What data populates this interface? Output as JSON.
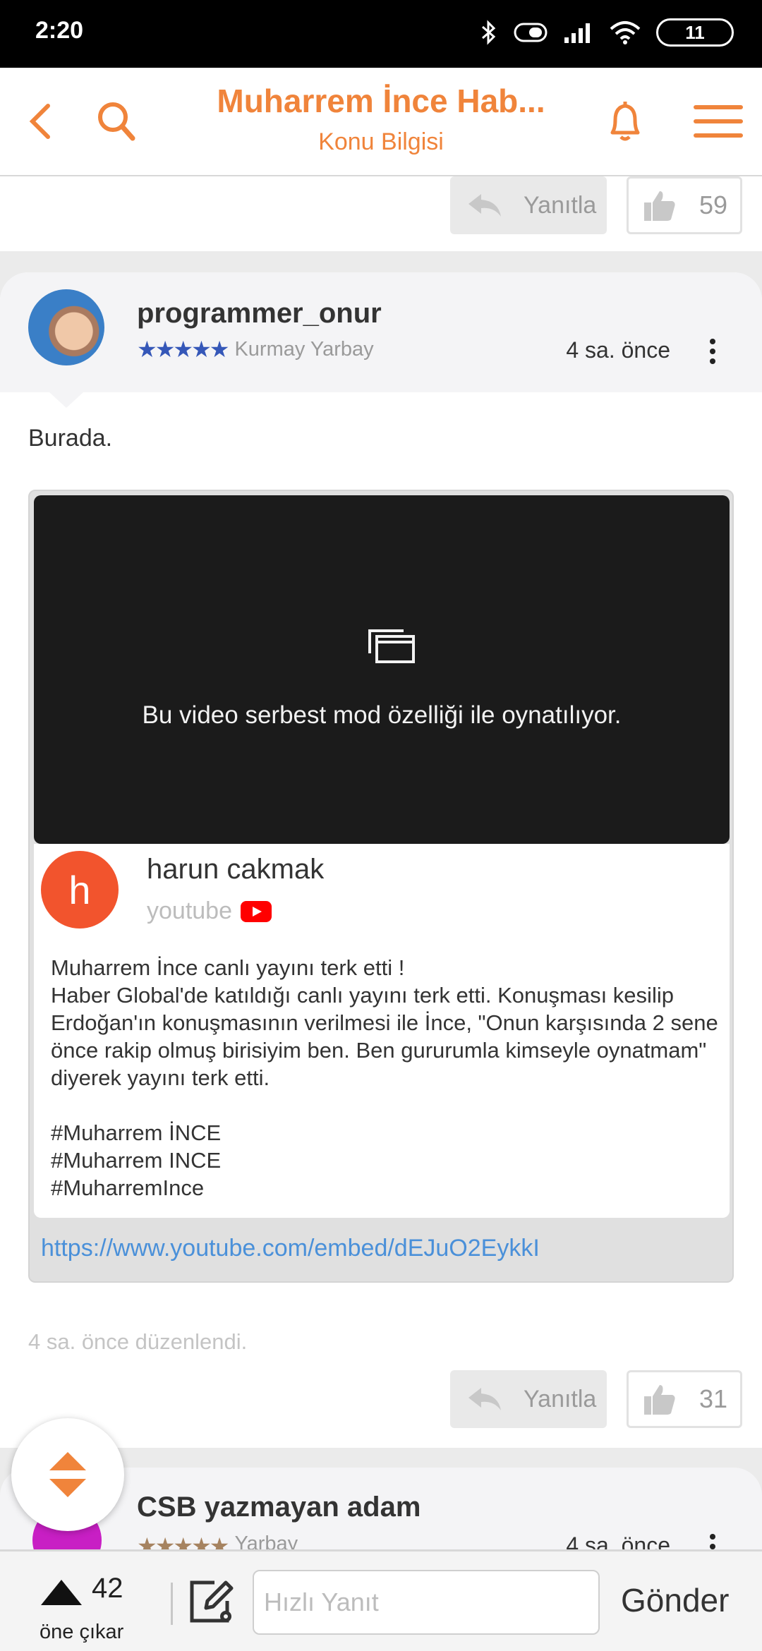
{
  "status_bar": {
    "time": "2:20",
    "battery": "11"
  },
  "header": {
    "title": "Muharrem İnce Hab...",
    "subtitle": "Konu Bilgisi",
    "icons": [
      "back-icon",
      "search-icon",
      "bell-icon",
      "menu-icon"
    ],
    "accent_color": "#f0843b"
  },
  "prev_post_actions": {
    "reply_label": "Yanıtla",
    "like_count": "59"
  },
  "post": {
    "username": "programmer_onur",
    "rank": "Kurmay Yarbay",
    "stars": "★★★★★",
    "time": "4 sa. önce",
    "body": "Burada.",
    "video_message": "Bu video serbest mod özelliği ile oynatılıyor.",
    "channel_initial": "h",
    "channel_name": "harun cakmak",
    "source": "youtube",
    "description": [
      "Muharrem İnce canlı yayını terk etti !\nHaber Global'de katıldığı canlı yayını terk etti. Konuşması kesilip Erdoğan'ın konuşmasının verilmesi ile İnce, \"Onun karşısında 2 sene önce rakip olmuş birisiyim ben. Ben gururumla kimseyle oynatmam\" diyerek yayını terk etti.",
      "#Muharrem İNCE\n#Muharrem INCE\n#MuharremInce"
    ],
    "link": "https://www.youtube.com/embed/dEJuO2EykkI",
    "edited": "4 sa. önce düzenlendi.",
    "reply_label": "Yanıtla",
    "like_count": "31"
  },
  "next_post": {
    "username": "CSB yazmayan adam",
    "rank": "Yarbay",
    "stars": "★★★★★",
    "time": "4 sa. önce"
  },
  "bottom_bar": {
    "vote_count": "42",
    "vote_label": "öne çıkar",
    "input_placeholder": "Hızlı Yanıt",
    "send_label": "Gönder"
  }
}
